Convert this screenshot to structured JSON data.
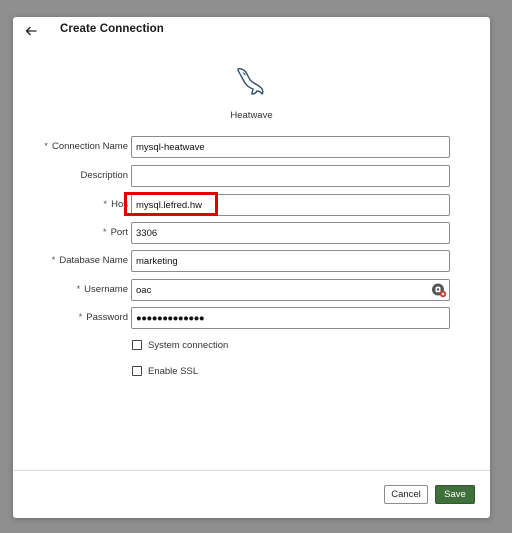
{
  "dialog": {
    "title": "Create Connection",
    "back_icon": "arrow-left-icon"
  },
  "source": {
    "logo_icon": "mysql-dolphin-icon",
    "label": "Heatwave"
  },
  "form": {
    "connection_name": {
      "label": "Connection Name",
      "required": "*",
      "value": "mysql-heatwave"
    },
    "description": {
      "label": "Description",
      "value": ""
    },
    "host": {
      "label": "Hos",
      "required": "*",
      "value": "mysql.lefred.hw"
    },
    "port": {
      "label": "Port",
      "required": "*",
      "value": "3306"
    },
    "database_name": {
      "label": "Database Name",
      "required": "*",
      "value": "marketing"
    },
    "username": {
      "label": "Username",
      "required": "*",
      "value": "oac",
      "icon": "password-manager-icon"
    },
    "password": {
      "label": "Password",
      "required": "*",
      "value": "●●●●●●●●●●●●●"
    },
    "system_connection": {
      "label": "System connection",
      "checked": false
    },
    "enable_ssl": {
      "label": "Enable SSL",
      "checked": false
    }
  },
  "footer": {
    "cancel_label": "Cancel",
    "save_label": "Save"
  },
  "colors": {
    "highlight": "#e00000",
    "save_button": "#3f6f3a",
    "overlay": "#8f8f8f"
  }
}
